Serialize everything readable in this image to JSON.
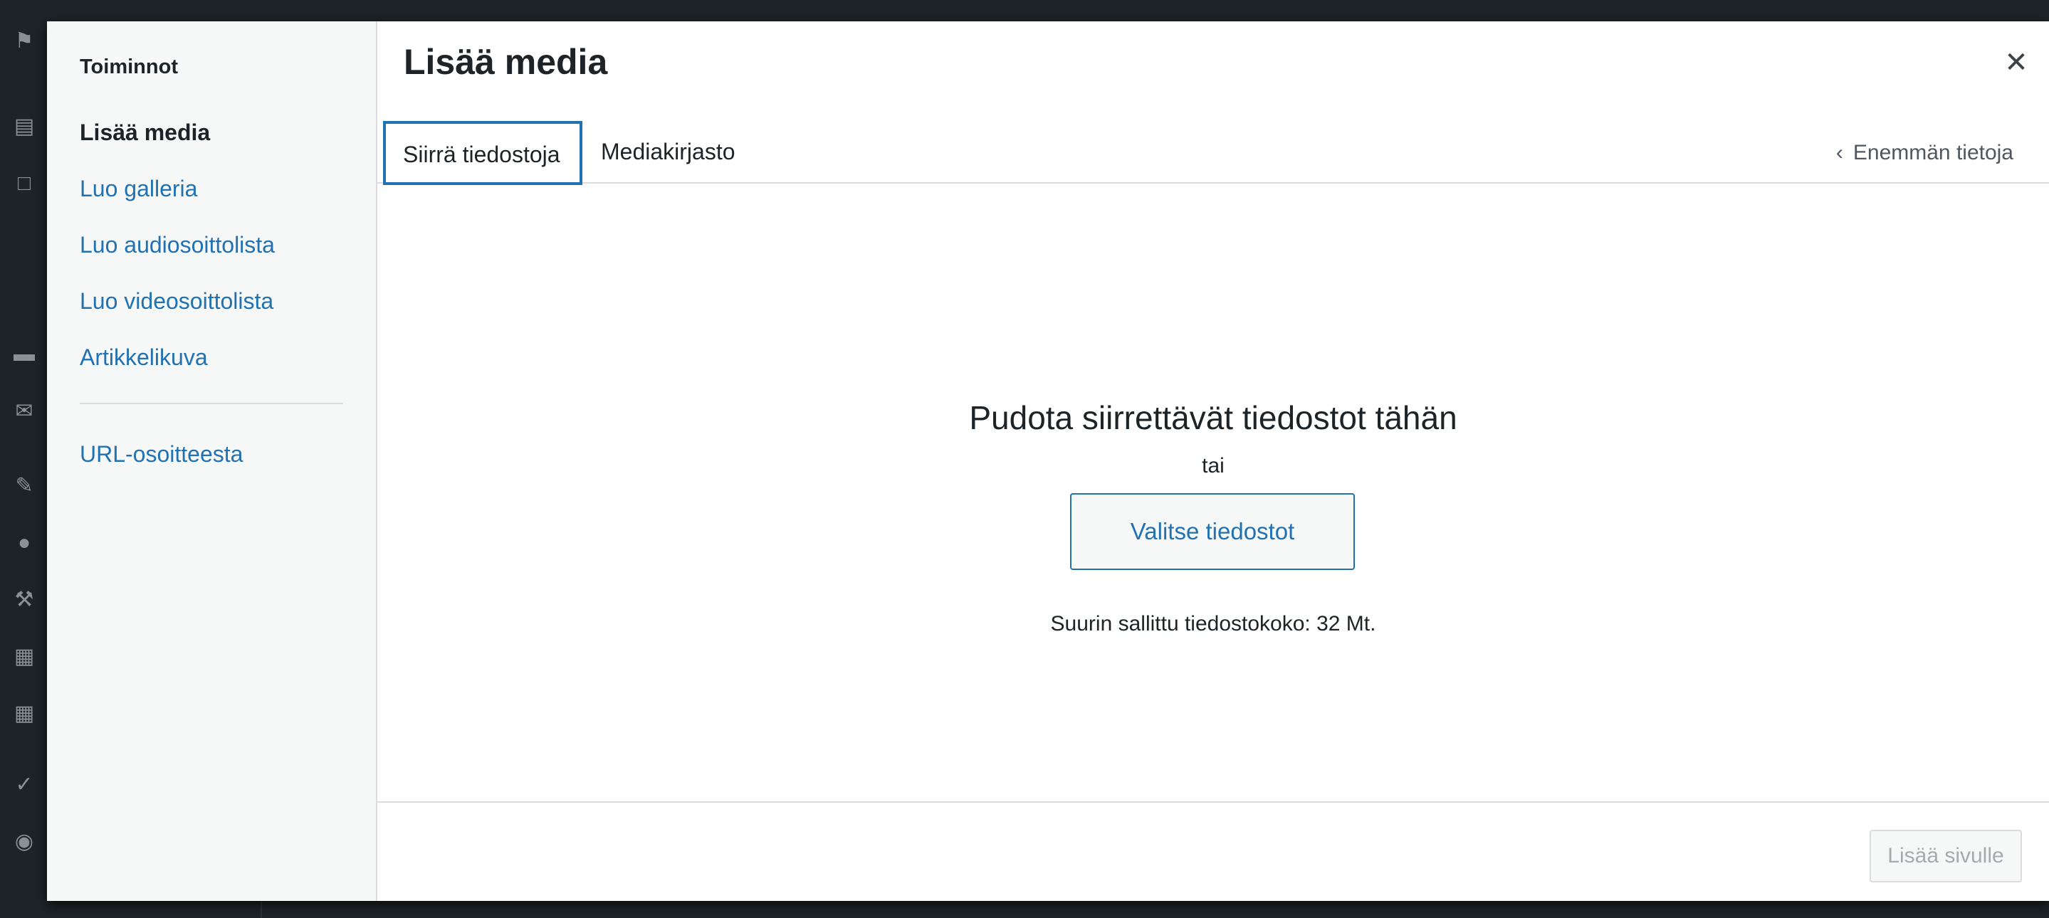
{
  "modal": {
    "title": "Lisää media",
    "close_icon": "close-icon"
  },
  "menu": {
    "heading": "Toiminnot",
    "items": [
      {
        "label": "Lisää media",
        "active": true
      },
      {
        "label": "Luo galleria",
        "active": false
      },
      {
        "label": "Luo audiosoittolista",
        "active": false
      },
      {
        "label": "Luo videosoittolista",
        "active": false
      },
      {
        "label": "Artikkelikuva",
        "active": false
      },
      {
        "label": "URL-osoitteesta",
        "active": false
      }
    ]
  },
  "tabs": [
    {
      "label": "Siirrä tiedostoja",
      "active": true
    },
    {
      "label": "Mediakirjasto",
      "active": false
    }
  ],
  "more_info": {
    "label": "Enemmän tietoja",
    "icon": "chevron-left-icon"
  },
  "uploader": {
    "drop_text": "Pudota siirrettävät tiedostot tähän",
    "or_text": "tai",
    "select_button": "Valitse tiedostot",
    "max_size": "Suurin sallittu tiedostokoko: 32 Mt."
  },
  "toolbar": {
    "insert_button": "Lisää sivulle"
  },
  "colors": {
    "accent": "#2271b1",
    "admin_bg": "#1d2327"
  }
}
